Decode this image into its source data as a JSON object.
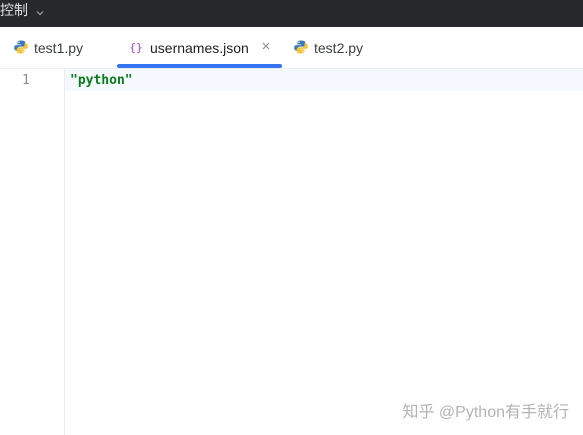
{
  "topbar": {
    "menu_label": "控制"
  },
  "tabs": [
    {
      "label": "test1.py",
      "icon": "python-file-icon",
      "active": false
    },
    {
      "label": "usernames.json",
      "icon": "json-file-icon",
      "active": true,
      "close_glyph": "×"
    },
    {
      "label": "test2.py",
      "icon": "python-file-icon",
      "active": false
    }
  ],
  "editor": {
    "lines": [
      {
        "number": "1",
        "text": "\"python\""
      }
    ]
  },
  "watermark": "知乎 @Python有手就行",
  "colors": {
    "topbar_bg": "#27282c",
    "accent": "#3574f0",
    "string_green": "#067d17",
    "json_icon_purple": "#9c3bd1",
    "python_blue": "#3d7ab8",
    "python_yellow": "#f5c53c"
  }
}
